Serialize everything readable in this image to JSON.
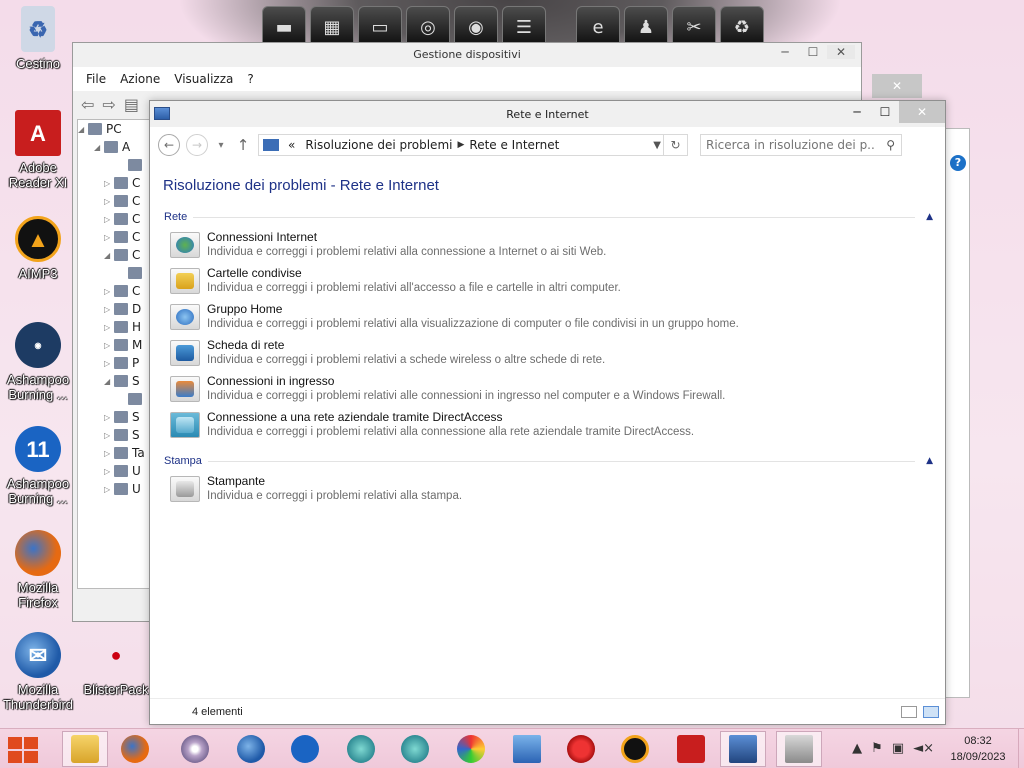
{
  "desktop": {
    "icons": [
      {
        "label": "Cestino",
        "icon": "recycle-bin-icon"
      },
      {
        "label": "Adobe Reader XI",
        "icon": "adobe-reader-icon"
      },
      {
        "label": "AIMP3",
        "icon": "aimp-icon"
      },
      {
        "label": "Ashampoo Burning ...",
        "icon": "ashampoo-burning-compact-icon"
      },
      {
        "label": "Ashampoo Burning ...",
        "icon": "ashampoo-burning-11-icon"
      },
      {
        "label": "Mozilla Firefox",
        "icon": "firefox-icon"
      },
      {
        "label": "Mozilla Thunderbird",
        "icon": "thunderbird-icon"
      },
      {
        "label": "BlisterPack",
        "icon": "blisterpack-icon"
      }
    ]
  },
  "back_window": {
    "title": "Gestione dispositivi",
    "menu": [
      "File",
      "Azione",
      "Visualizza",
      "?"
    ],
    "tree_root": "PC",
    "tree_rows": [
      "A",
      "",
      "C",
      "C",
      "C",
      "C",
      "C",
      "",
      "C",
      "D",
      "H",
      "M",
      "P",
      "S",
      "",
      "S",
      "S",
      "Ta",
      "U",
      "U"
    ]
  },
  "window": {
    "title": "Rete e Internet",
    "address": {
      "prefix": "«",
      "crumbs": [
        "Risoluzione dei problemi",
        "Rete e Internet"
      ]
    },
    "search_placeholder": "Ricerca in risoluzione dei p...",
    "page_title": "Risoluzione dei problemi - Rete e Internet",
    "groups": [
      {
        "name": "Rete",
        "items": [
          {
            "title": "Connessioni Internet",
            "desc": "Individua e correggi i problemi relativi alla connessione a Internet o ai siti Web.",
            "icon": "internet-globe-icon"
          },
          {
            "title": "Cartelle condivise",
            "desc": "Individua e correggi i problemi relativi all'accesso a file e cartelle in altri computer.",
            "icon": "shared-folder-icon"
          },
          {
            "title": "Gruppo Home",
            "desc": "Individua e correggi i problemi relativi alla visualizzazione di computer o file condivisi in un gruppo home.",
            "icon": "homegroup-icon"
          },
          {
            "title": "Scheda di rete",
            "desc": "Individua e correggi i problemi relativi a schede wireless o altre schede di rete.",
            "icon": "network-adapter-icon"
          },
          {
            "title": "Connessioni in ingresso",
            "desc": "Individua e correggi i problemi relativi alle connessioni in ingresso nel computer e a Windows Firewall.",
            "icon": "incoming-connection-icon"
          },
          {
            "title": "Connessione a una rete aziendale tramite DirectAccess",
            "desc": "Individua e correggi i problemi relativi alla connessione alla rete aziendale tramite DirectAccess.",
            "icon": "directaccess-icon"
          }
        ]
      },
      {
        "name": "Stampa",
        "items": [
          {
            "title": "Stampante",
            "desc": "Individua e correggi i problemi relativi alla stampa.",
            "icon": "printer-icon"
          }
        ]
      }
    ],
    "status": "4 elementi"
  },
  "taskbar": {
    "clock_time": "08:32",
    "clock_date": "18/09/2023",
    "pinned": [
      "file-explorer-icon",
      "firefox-icon",
      "dvd-icon",
      "thunderbird-icon",
      "ashampoo-icon",
      "globe-icon",
      "globe2-icon",
      "paint-icon",
      "windows-icon",
      "hat-icon",
      "aimp-icon",
      "adobe-reader-icon",
      "control-panel-icon",
      "device-manager-icon"
    ]
  },
  "colors": {
    "link_blue": "#1e3287",
    "taskbar_pink": "#f5d5e3",
    "desktop_pink": "#f4dcea"
  }
}
